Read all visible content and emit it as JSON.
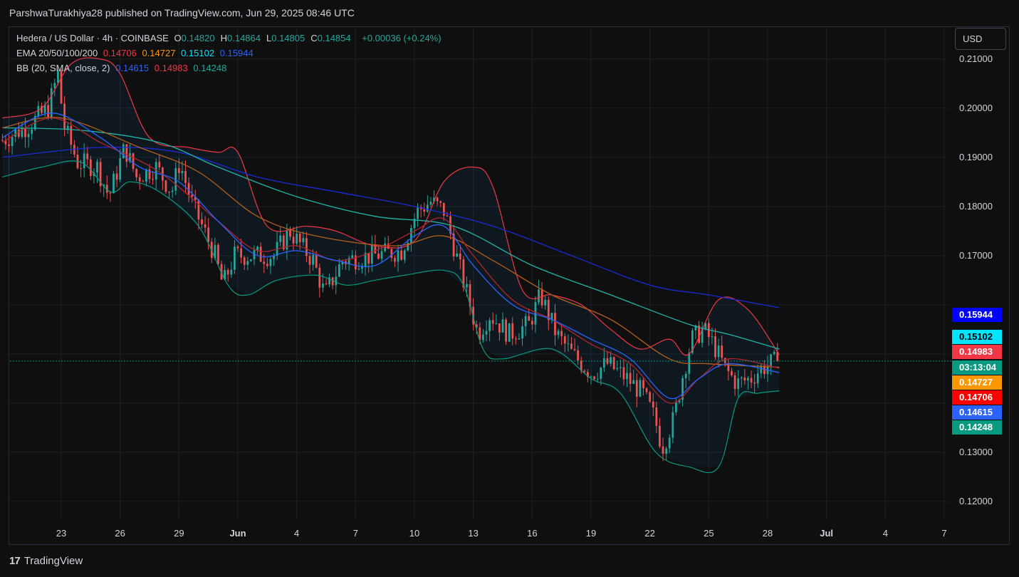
{
  "published_line": "ParshwaTurakhiya28 published on TradingView.com, Jun 29, 2025 08:46 UTC",
  "currency_button": "USD",
  "footer_brand": "TradingView",
  "legend": {
    "symbol": "Hedera / US Dollar · 4h · COINBASE",
    "ohlc": [
      {
        "k": "O",
        "v": "0.14820"
      },
      {
        "k": "H",
        "v": "0.14864"
      },
      {
        "k": "L",
        "v": "0.14805"
      },
      {
        "k": "C",
        "v": "0.14854"
      }
    ],
    "change": "+0.00036 (+0.24%)",
    "ema_label": "EMA 20/50/100/200",
    "ema_values": [
      "0.14706",
      "0.14727",
      "0.15102",
      "0.15944"
    ],
    "bb_label": "BB (20, SMA, close, 2)",
    "bb_values": [
      "0.14615",
      "0.14983",
      "0.14248"
    ]
  },
  "colors": {
    "up": "#26a69a",
    "down": "#ef5350",
    "ema20": "#f23645",
    "ema50": "#ff9800",
    "ema100": "#00e5ff",
    "ema200": "#2962ff",
    "bb_basis": "#2962ff",
    "bb_upper": "#f23645",
    "bb_lower": "#089981"
  },
  "price_tags": [
    {
      "value": "0.15944",
      "color": "#0000ff",
      "text": "#ffffff"
    },
    {
      "value": "0.15102",
      "color": "#00e5ff",
      "text": "#000000"
    },
    {
      "value": "0.14983",
      "color": "#f23645",
      "text": "#ffffff"
    },
    {
      "value": "03:13:04",
      "color": "#089981",
      "text": "#ffffff"
    },
    {
      "value": "0.14727",
      "color": "#ff9800",
      "text": "#ffffff"
    },
    {
      "value": "0.14706",
      "color": "#ff0000",
      "text": "#ffffff"
    },
    {
      "value": "0.14615",
      "color": "#2962ff",
      "text": "#ffffff"
    },
    {
      "value": "0.14248",
      "color": "#089981",
      "text": "#ffffff"
    }
  ],
  "chart_data": {
    "type": "candlestick",
    "ylim": [
      0.1165,
      0.2165
    ],
    "y_ticks": [
      "0.12000",
      "0.13000",
      "0.17000",
      "0.18000",
      "0.19000",
      "0.20000",
      "0.21000"
    ],
    "x_ticks": [
      "23",
      "26",
      "29",
      "Jun",
      "4",
      "7",
      "10",
      "13",
      "16",
      "19",
      "22",
      "25",
      "28",
      "Jul",
      "4",
      "7"
    ],
    "x_tick_days": [
      -8,
      -5,
      -2,
      1,
      4,
      7,
      10,
      13,
      16,
      19,
      22,
      25,
      28,
      31,
      34,
      37
    ],
    "last_price": 0.14854,
    "key_points": [
      [
        -10.8,
        0.1935
      ],
      [
        -9.5,
        0.1965
      ],
      [
        -8.5,
        0.2
      ],
      [
        -8.0,
        0.207
      ],
      [
        -7.7,
        0.1965
      ],
      [
        -7.0,
        0.189
      ],
      [
        -6.0,
        0.188
      ],
      [
        -5.4,
        0.182
      ],
      [
        -4.6,
        0.192
      ],
      [
        -4.0,
        0.186
      ],
      [
        -3.0,
        0.188
      ],
      [
        -2.2,
        0.183
      ],
      [
        -1.8,
        0.189
      ],
      [
        -1.2,
        0.181
      ],
      [
        0.0,
        0.17
      ],
      [
        0.4,
        0.164
      ],
      [
        1.0,
        0.17
      ],
      [
        2.0,
        0.17
      ],
      [
        3.0,
        0.17
      ],
      [
        3.8,
        0.175
      ],
      [
        5.0,
        0.169
      ],
      [
        5.6,
        0.162
      ],
      [
        6.5,
        0.169
      ],
      [
        8.0,
        0.17
      ],
      [
        9.5,
        0.171
      ],
      [
        10.3,
        0.179
      ],
      [
        11.0,
        0.181
      ],
      [
        11.7,
        0.179
      ],
      [
        12.3,
        0.17
      ],
      [
        13.0,
        0.16
      ],
      [
        13.4,
        0.154
      ],
      [
        14.0,
        0.158
      ],
      [
        15.0,
        0.154
      ],
      [
        16.0,
        0.156
      ],
      [
        16.6,
        0.162
      ],
      [
        17.4,
        0.154
      ],
      [
        18.2,
        0.15
      ],
      [
        19.2,
        0.146
      ],
      [
        20.0,
        0.148
      ],
      [
        21.0,
        0.145
      ],
      [
        21.8,
        0.142
      ],
      [
        22.4,
        0.137
      ],
      [
        22.8,
        0.131
      ],
      [
        23.4,
        0.137
      ],
      [
        23.8,
        0.145
      ],
      [
        24.3,
        0.153
      ],
      [
        24.9,
        0.155
      ],
      [
        25.4,
        0.152
      ],
      [
        26.0,
        0.147
      ],
      [
        26.6,
        0.144
      ],
      [
        27.3,
        0.145
      ],
      [
        27.8,
        0.147
      ],
      [
        28.6,
        0.1485
      ]
    ],
    "ema20": [
      [
        -11,
        0.193
      ],
      [
        -8.5,
        0.198
      ],
      [
        -6,
        0.193
      ],
      [
        -3,
        0.187
      ],
      [
        0,
        0.177
      ],
      [
        2,
        0.171
      ],
      [
        4,
        0.172
      ],
      [
        6,
        0.169
      ],
      [
        8,
        0.171
      ],
      [
        10,
        0.175
      ],
      [
        11.5,
        0.1775
      ],
      [
        13,
        0.17
      ],
      [
        15,
        0.161
      ],
      [
        17,
        0.157
      ],
      [
        19,
        0.152
      ],
      [
        21,
        0.148
      ],
      [
        23,
        0.14
      ],
      [
        24.5,
        0.145
      ],
      [
        26,
        0.149
      ],
      [
        28.6,
        0.1471
      ]
    ],
    "ema50": [
      [
        -11,
        0.196
      ],
      [
        -8,
        0.198
      ],
      [
        -4,
        0.192
      ],
      [
        -1,
        0.187
      ],
      [
        2,
        0.178
      ],
      [
        5,
        0.174
      ],
      [
        9,
        0.172
      ],
      [
        11.5,
        0.174
      ],
      [
        14,
        0.169
      ],
      [
        17,
        0.162
      ],
      [
        20,
        0.157
      ],
      [
        23,
        0.149
      ],
      [
        25,
        0.148
      ],
      [
        28.6,
        0.1473
      ]
    ],
    "ema100": [
      [
        -11,
        0.196
      ],
      [
        -7,
        0.1955
      ],
      [
        -3,
        0.193
      ],
      [
        0,
        0.188
      ],
      [
        4,
        0.182
      ],
      [
        8,
        0.178
      ],
      [
        12,
        0.176
      ],
      [
        16,
        0.168
      ],
      [
        20,
        0.162
      ],
      [
        24,
        0.156
      ],
      [
        26,
        0.154
      ],
      [
        28.6,
        0.151
      ]
    ],
    "ema200": [
      [
        -11,
        0.19
      ],
      [
        -6,
        0.192
      ],
      [
        -2,
        0.191
      ],
      [
        2,
        0.186
      ],
      [
        6,
        0.183
      ],
      [
        10,
        0.18
      ],
      [
        14,
        0.176
      ],
      [
        18,
        0.17
      ],
      [
        22,
        0.164
      ],
      [
        25,
        0.162
      ],
      [
        28.6,
        0.1594
      ]
    ],
    "bb_upper": [
      [
        -11,
        0.198
      ],
      [
        -9,
        0.2
      ],
      [
        -7.5,
        0.209
      ],
      [
        -6,
        0.21
      ],
      [
        -5,
        0.207
      ],
      [
        -3.5,
        0.194
      ],
      [
        -1.5,
        0.192
      ],
      [
        0,
        0.191
      ],
      [
        1,
        0.191
      ],
      [
        2.5,
        0.176
      ],
      [
        4.5,
        0.176
      ],
      [
        6,
        0.175
      ],
      [
        8,
        0.172
      ],
      [
        10,
        0.173
      ],
      [
        11.5,
        0.185
      ],
      [
        13,
        0.188
      ],
      [
        14,
        0.184
      ],
      [
        15.5,
        0.163
      ],
      [
        17,
        0.162
      ],
      [
        18.5,
        0.16
      ],
      [
        20,
        0.155
      ],
      [
        21.5,
        0.151
      ],
      [
        23.0,
        0.153
      ],
      [
        24.0,
        0.15
      ],
      [
        25.5,
        0.161
      ],
      [
        27.0,
        0.159
      ],
      [
        28.6,
        0.1498
      ]
    ],
    "bb_basis": [
      [
        -11,
        0.194
      ],
      [
        -8.5,
        0.199
      ],
      [
        -6,
        0.194
      ],
      [
        -4,
        0.188
      ],
      [
        -2,
        0.185
      ],
      [
        0,
        0.177
      ],
      [
        2,
        0.17
      ],
      [
        4,
        0.171
      ],
      [
        6,
        0.169
      ],
      [
        8,
        0.168
      ],
      [
        10,
        0.174
      ],
      [
        11.5,
        0.176
      ],
      [
        13,
        0.168
      ],
      [
        15,
        0.16
      ],
      [
        17,
        0.157
      ],
      [
        19,
        0.153
      ],
      [
        21,
        0.149
      ],
      [
        23,
        0.141
      ],
      [
        24.5,
        0.145
      ],
      [
        26,
        0.148
      ],
      [
        28.6,
        0.1462
      ]
    ],
    "bb_lower": [
      [
        -11,
        0.186
      ],
      [
        -9,
        0.188
      ],
      [
        -7,
        0.189
      ],
      [
        -5.5,
        0.183
      ],
      [
        -4.5,
        0.185
      ],
      [
        -3,
        0.183
      ],
      [
        -1,
        0.176
      ],
      [
        0.5,
        0.164
      ],
      [
        1.5,
        0.162
      ],
      [
        3,
        0.165
      ],
      [
        5,
        0.166
      ],
      [
        6.5,
        0.164
      ],
      [
        8,
        0.165
      ],
      [
        9.5,
        0.166
      ],
      [
        11.5,
        0.167
      ],
      [
        12.5,
        0.164
      ],
      [
        13.5,
        0.151
      ],
      [
        14.5,
        0.149
      ],
      [
        17,
        0.151
      ],
      [
        19,
        0.145
      ],
      [
        20.5,
        0.142
      ],
      [
        22.3,
        0.13
      ],
      [
        24,
        0.127
      ],
      [
        25.5,
        0.127
      ],
      [
        26.5,
        0.141
      ],
      [
        27.5,
        0.142
      ],
      [
        28.6,
        0.1425
      ]
    ]
  }
}
